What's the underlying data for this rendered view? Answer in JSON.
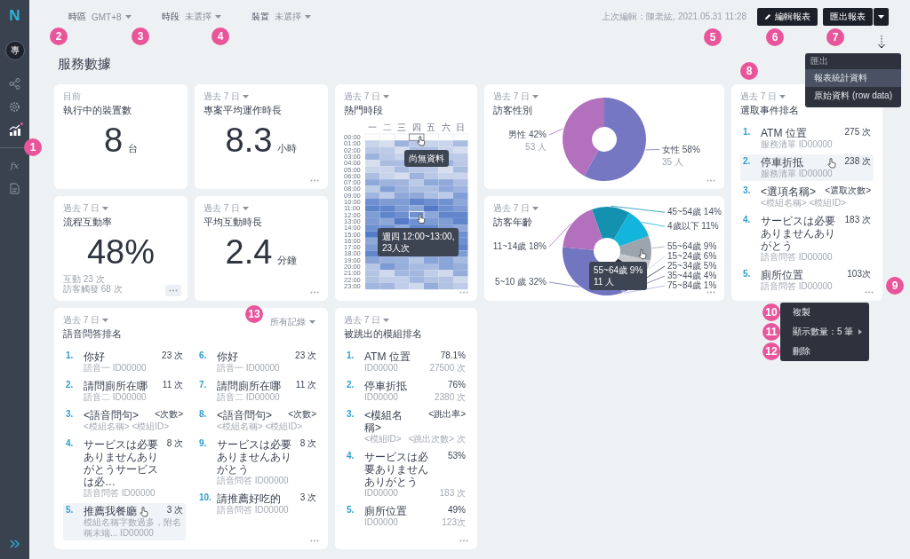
{
  "sidebar": {
    "logo": "N",
    "avatar": "專",
    "nav": [
      {
        "selected": false,
        "badge": false
      },
      {
        "selected": false,
        "badge": false
      },
      {
        "selected": true,
        "badge": true
      },
      {
        "label": "fx",
        "selected": false,
        "badge": false
      },
      {
        "selected": false,
        "badge": false
      }
    ]
  },
  "toolbar": {
    "filters": [
      {
        "label": "時區",
        "value": "GMT+8"
      },
      {
        "label": "時段",
        "value": "未選擇"
      },
      {
        "label": "裝置",
        "value": "未選擇"
      }
    ],
    "last_edited": "上次編輯：陳老紘, 2021.05.31 11:28",
    "buttons": [
      {
        "label": "編輯報表",
        "kind": "edit"
      },
      {
        "label": "匯出報表",
        "kind": "split"
      }
    ]
  },
  "export_menu": {
    "header": "匯出",
    "items": [
      {
        "label": "報表統計資料",
        "selected": true
      },
      {
        "label": "原始資料 (row data)",
        "selected": false
      }
    ]
  },
  "page_title": "服務數據",
  "cards": [
    {
      "kind": "stat",
      "period": "目前",
      "period_menu": false,
      "title": "執行中的裝置數",
      "value": "8",
      "unit": "台"
    },
    {
      "kind": "stat",
      "period": "過去 7 日",
      "period_menu": true,
      "title": "流程互動率",
      "value": "48%",
      "notes": [
        "互動 23 次",
        "訪客觸發 68 次"
      ],
      "more_active": true
    },
    {
      "kind": "stat",
      "period": "過去 7 日",
      "period_menu": true,
      "title": "專案平均運作時長",
      "value": "8.3",
      "unit": "小時",
      "more_active": false
    },
    {
      "kind": "stat",
      "period": "過去 7 日",
      "period_menu": true,
      "title": "平均互動時長",
      "value": "2.4",
      "unit": "分鐘",
      "more_active": false
    },
    {
      "kind": "heatmap",
      "period": "過去 7 日",
      "period_menu": true,
      "title": "熱門時段",
      "days": [
        "一",
        "二",
        "三",
        "四",
        "五",
        "六",
        "日"
      ],
      "hours": [
        "00:00",
        "01:00",
        "02:00",
        "03:00",
        "04:00",
        "05:00",
        "06:00",
        "07:00",
        "08:00",
        "09:00",
        "10:00",
        "11:00",
        "12:00",
        "13:00",
        "14:00",
        "15:00",
        "16:00",
        "17:00",
        "18:00",
        "19:00",
        "20:00",
        "21:00",
        "22:00",
        "23:00"
      ],
      "tooltips": [
        {
          "lines": [
            "尚無資料"
          ]
        },
        {
          "lines": [
            "週四 12:00~13:00,",
            "23人次"
          ]
        }
      ],
      "more_active": false
    },
    {
      "kind": "donut",
      "period": "過去 7 日",
      "period_menu": true,
      "title": "訪客性別",
      "more_active": false,
      "chart_data": {
        "type": "donut",
        "values": [
          58,
          42
        ],
        "value_labels": [
          "女性 58%",
          "男性 42%"
        ],
        "colors": [
          "#7577c2",
          "#b270bd"
        ]
      },
      "counts": [
        "35 人",
        "53 人"
      ]
    },
    {
      "kind": "donut",
      "period": "過去 7 日",
      "period_menu": true,
      "title": "訪客年齡",
      "more_active": false,
      "chart_data": {
        "type": "donut",
        "values": [
          14,
          11,
          9,
          6,
          5,
          4,
          1,
          32,
          18
        ],
        "value_labels": [
          "45~54歲 14%",
          "4歲以下 11%",
          "55~64歲 9%",
          "15~24歲 6%",
          "25~34歲 5%",
          "35~44歲 4%",
          "75~84歲 1%",
          "5~10 歲 32%",
          "11~14歲 18%"
        ],
        "colors": [
          "#1591b0",
          "#13b5dc",
          "#9ca4ae",
          "#c6c9cd",
          "#2e3340",
          "#7a68a6",
          "#a8ace6",
          "#7275c0",
          "#b270bd"
        ]
      },
      "tooltip": [
        "55~64歲 9%",
        "11 人"
      ]
    },
    {
      "kind": "ranking",
      "period": "過去 7 日",
      "period_menu": true,
      "title": "選取事件排名",
      "more_active": false,
      "items": [
        {
          "rank": "1.",
          "name": "ATM 位置",
          "sub": "服務清單 ID00000",
          "value": "275 次",
          "highlighted": false
        },
        {
          "rank": "2.",
          "name": "停車折抵",
          "sub": "服務清單 ID00000",
          "value": "238 次",
          "highlighted": true
        },
        {
          "rank": "3.",
          "name": "<選項名稱>",
          "sub": "<模組名稱> <模組ID>",
          "value": "<選取次數>",
          "highlighted": false
        },
        {
          "rank": "4.",
          "name": "サービスは必要ありませんありがとう",
          "sub": "語音問答 ID00000",
          "value": "183 次",
          "highlighted": false
        },
        {
          "rank": "5.",
          "name": "廁所位置",
          "sub": "語音問答 ID00000",
          "value": "103次",
          "highlighted": false
        }
      ]
    },
    {
      "kind": "ranking",
      "period": "過去 7 日",
      "period_menu": true,
      "title": "語音問答排名",
      "filter": "所有記錄",
      "more_active": false,
      "items": [
        {
          "rank": "1.",
          "name": "你好",
          "sub": "語音一 ID00000",
          "value": "23 次",
          "highlighted": false
        },
        {
          "rank": "2.",
          "name": "請問廁所在哪",
          "sub": "語音二 ID00000",
          "value": "11 次",
          "highlighted": false
        },
        {
          "rank": "3.",
          "name": "<語音問句>",
          "sub": "<模組名稱> <模組ID>",
          "value": "<次數>",
          "highlighted": false
        },
        {
          "rank": "4.",
          "name": "サービスは必要ありませんありがとうサービスは必…",
          "sub": "語音問答 ID00000",
          "value": "8 次",
          "highlighted": false
        },
        {
          "rank": "5.",
          "name": "推薦我餐廳",
          "sub": "模組名稱字數過多，附名稱末端... ID00000",
          "value": "3 次",
          "highlighted": true
        },
        {
          "rank": "6.",
          "name": "你好",
          "sub": "語音一 ID00000",
          "value": "23 次",
          "highlighted": false
        },
        {
          "rank": "7.",
          "name": "請問廁所在哪",
          "sub": "語音二 ID00000",
          "value": "11 次",
          "highlighted": false
        },
        {
          "rank": "8.",
          "name": "<語音問句>",
          "sub": "<模組名稱> <模組ID>",
          "value": "<次數>",
          "highlighted": false
        },
        {
          "rank": "9.",
          "name": "サービスは必要ありませんありがとう",
          "sub": "語音問答 ID00000",
          "value": "8 次",
          "highlighted": false
        },
        {
          "rank": "10.",
          "name": "請推薦好吃的",
          "sub": "語音問答 ID00000",
          "value": "3 次",
          "highlighted": false
        }
      ]
    },
    {
      "kind": "ranking",
      "period": "過去 7 日",
      "period_menu": true,
      "title": "被跳出的模組排名",
      "more_active": false,
      "items": [
        {
          "rank": "1.",
          "name": "ATM 位置",
          "sub": "ID00000",
          "value": "78.1%",
          "subvalue": "27500 次",
          "highlighted": false
        },
        {
          "rank": "2.",
          "name": "停車折抵",
          "sub": "ID00000",
          "value": "76%",
          "subvalue": "2380 次",
          "highlighted": false
        },
        {
          "rank": "3.",
          "name": "<模組名稱>",
          "sub": "<模組ID>",
          "value": "<跳出率>",
          "subvalue": "<跳出次數> 次",
          "highlighted": false
        },
        {
          "rank": "4.",
          "name": "サービスは必要ありませんありがとう",
          "sub": "ID00000",
          "value": "53%",
          "subvalue": "183 次",
          "highlighted": false
        },
        {
          "rank": "5.",
          "name": "廁所位置",
          "sub": "ID00000",
          "value": "49%",
          "subvalue": "123次",
          "highlighted": false
        }
      ]
    }
  ],
  "context_menu": {
    "items": [
      {
        "label": "複製",
        "submenu": false
      },
      {
        "label": "顯示數量：5 筆",
        "submenu": true
      },
      {
        "label": "刪除",
        "submenu": false
      }
    ]
  },
  "annotations": [
    "1",
    "2",
    "3",
    "4",
    "5",
    "6",
    "7",
    "8",
    "9",
    "10",
    "11",
    "12",
    "13"
  ]
}
